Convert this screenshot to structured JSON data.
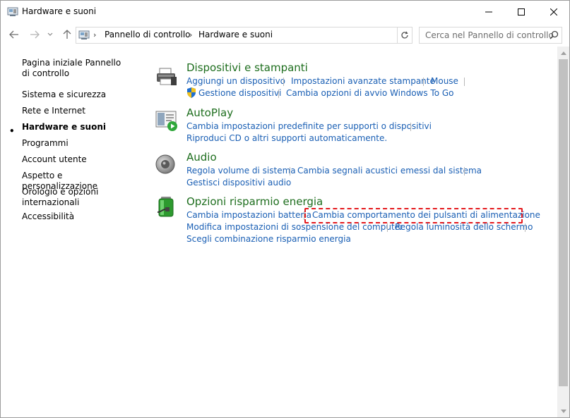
{
  "window": {
    "title": "Hardware e suoni"
  },
  "nav": {
    "breadcrumbs": [
      "Pannello di controllo",
      "Hardware e suoni"
    ],
    "search_placeholder": "Cerca nel Pannello di controllo"
  },
  "sidebar": {
    "items": [
      {
        "label": "Pagina iniziale Pannello di controllo",
        "active": false
      },
      {
        "label": "Sistema e sicurezza",
        "active": false
      },
      {
        "label": "Rete e Internet",
        "active": false
      },
      {
        "label": "Hardware e suoni",
        "active": true
      },
      {
        "label": "Programmi",
        "active": false
      },
      {
        "label": "Account utente",
        "active": false
      },
      {
        "label": "Aspetto e personalizzazione",
        "active": false
      },
      {
        "label": "Orologio e opzioni internazionali",
        "active": false
      },
      {
        "label": "Accessibilità",
        "active": false
      }
    ]
  },
  "categories": [
    {
      "title": "Dispositivi e stampanti",
      "icon": "printer-icon",
      "links": [
        "Aggiungi un dispositivo",
        "Impostazioni avanzate stampante",
        "Mouse",
        "Gestione dispositivi",
        "Cambia opzioni di avvio Windows To Go"
      ]
    },
    {
      "title": "AutoPlay",
      "icon": "autoplay-icon",
      "links": [
        "Cambia impostazioni predefinite per supporti o dispositivi",
        "Riproduci CD o altri supporti automaticamente."
      ]
    },
    {
      "title": "Audio",
      "icon": "speaker-icon",
      "links": [
        "Regola volume di sistema",
        "Cambia segnali acustici emessi dal sistema",
        "Gestisci dispositivi audio"
      ]
    },
    {
      "title": "Opzioni risparmio energia",
      "icon": "battery-icon",
      "links": [
        "Cambia impostazioni batteria",
        "Cambia comportamento dei pulsanti di alimentazione",
        "Modifica impostazioni di sospensione del computer",
        "Regola luminosità dello schermo",
        "Scegli combinazione risparmio energia"
      ]
    }
  ],
  "colors": {
    "category_title": "#1e6e1e",
    "link": "#1a5fb4",
    "highlight": "#e4191d"
  }
}
